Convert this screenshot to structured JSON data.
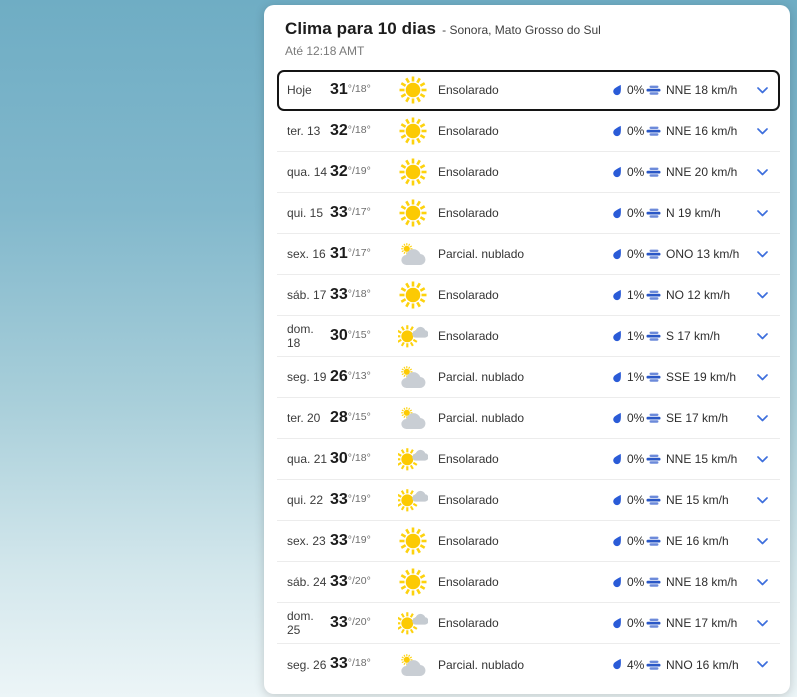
{
  "header": {
    "title": "Clima para 10 dias",
    "location": "- Sonora, Mato Grosso do Sul",
    "updated": "Até 12:18 AMT"
  },
  "units": {
    "degree": "°",
    "separator": "/"
  },
  "colors": {
    "accent_blue": "#2a5bd7",
    "sun_yellow": "#fcca03",
    "cloud_gray": "#c9ced4",
    "focus_border": "#141414",
    "background_top": "#6fadc4",
    "background_bottom": "#ecf5f7"
  },
  "forecast": {
    "rows": [
      {
        "day": "Hoje",
        "high": "31",
        "low": "18",
        "condition": "Ensolarado",
        "icon": "sunny",
        "precip": "0%",
        "wind": "NNE 18 km/h",
        "selected": true
      },
      {
        "day": "ter. 13",
        "high": "32",
        "low": "18",
        "condition": "Ensolarado",
        "icon": "sunny",
        "precip": "0%",
        "wind": "NNE 16 km/h",
        "selected": false
      },
      {
        "day": "qua. 14",
        "high": "32",
        "low": "19",
        "condition": "Ensolarado",
        "icon": "sunny",
        "precip": "0%",
        "wind": "NNE 20 km/h",
        "selected": false
      },
      {
        "day": "qui. 15",
        "high": "33",
        "low": "17",
        "condition": "Ensolarado",
        "icon": "sunny",
        "precip": "0%",
        "wind": "N 19 km/h",
        "selected": false
      },
      {
        "day": "sex. 16",
        "high": "31",
        "low": "17",
        "condition": "Parcial. nublado",
        "icon": "partly-cloudy",
        "precip": "0%",
        "wind": "ONO 13 km/h",
        "selected": false
      },
      {
        "day": "sáb. 17",
        "high": "33",
        "low": "18",
        "condition": "Ensolarado",
        "icon": "sunny",
        "precip": "1%",
        "wind": "NO 12 km/h",
        "selected": false
      },
      {
        "day": "dom. 18",
        "high": "30",
        "low": "15",
        "condition": "Ensolarado",
        "icon": "mostly-sunny",
        "precip": "1%",
        "wind": "S 17 km/h",
        "selected": false
      },
      {
        "day": "seg. 19",
        "high": "26",
        "low": "13",
        "condition": "Parcial. nublado",
        "icon": "partly-cloudy",
        "precip": "1%",
        "wind": "SSE 19 km/h",
        "selected": false
      },
      {
        "day": "ter. 20",
        "high": "28",
        "low": "15",
        "condition": "Parcial. nublado",
        "icon": "partly-cloudy",
        "precip": "0%",
        "wind": "SE 17 km/h",
        "selected": false
      },
      {
        "day": "qua. 21",
        "high": "30",
        "low": "18",
        "condition": "Ensolarado",
        "icon": "mostly-sunny",
        "precip": "0%",
        "wind": "NNE 15 km/h",
        "selected": false
      },
      {
        "day": "qui. 22",
        "high": "33",
        "low": "19",
        "condition": "Ensolarado",
        "icon": "mostly-sunny",
        "precip": "0%",
        "wind": "NE 15 km/h",
        "selected": false
      },
      {
        "day": "sex. 23",
        "high": "33",
        "low": "19",
        "condition": "Ensolarado",
        "icon": "sunny",
        "precip": "0%",
        "wind": "NE 16 km/h",
        "selected": false
      },
      {
        "day": "sáb. 24",
        "high": "33",
        "low": "20",
        "condition": "Ensolarado",
        "icon": "sunny",
        "precip": "0%",
        "wind": "NNE 18 km/h",
        "selected": false
      },
      {
        "day": "dom. 25",
        "high": "33",
        "low": "20",
        "condition": "Ensolarado",
        "icon": "mostly-sunny",
        "precip": "0%",
        "wind": "NNE 17 km/h",
        "selected": false
      },
      {
        "day": "seg. 26",
        "high": "33",
        "low": "18",
        "condition": "Parcial. nublado",
        "icon": "partly-cloudy",
        "precip": "4%",
        "wind": "NNO 16 km/h",
        "selected": false
      }
    ]
  }
}
